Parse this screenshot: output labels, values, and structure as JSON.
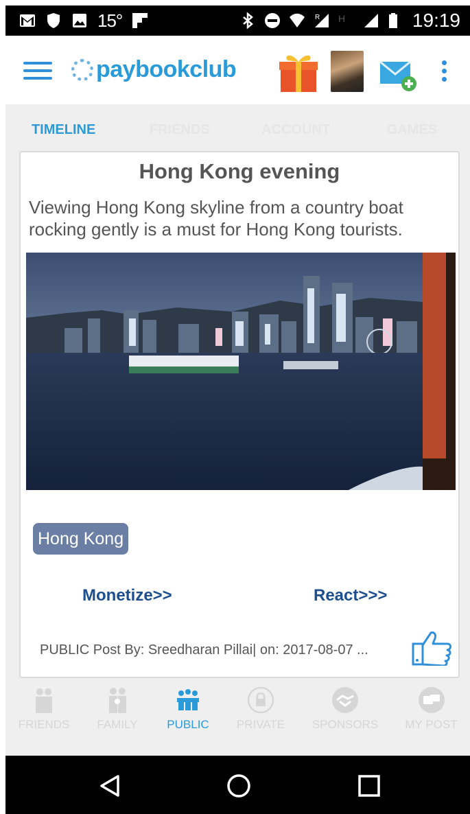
{
  "status_bar": {
    "temperature": "15°",
    "time": "19:19",
    "icons": [
      "gmail-icon",
      "shield-icon",
      "image-icon",
      "flipboard-icon",
      "bluetooth-icon",
      "do-not-disturb-icon",
      "wifi-icon",
      "roaming-signal-icon",
      "h-network-icon",
      "signal-icon",
      "battery-icon"
    ]
  },
  "app_bar": {
    "logo_text": "paybookclub",
    "icons": [
      "menu-icon",
      "gift-icon",
      "profile-avatar",
      "mail-add-icon",
      "more-vert-icon"
    ]
  },
  "tabs": [
    {
      "label": "TIMELINE",
      "active": true
    },
    {
      "label": "FRIENDS",
      "active": false
    },
    {
      "label": "ACCOUNT",
      "active": false
    },
    {
      "label": "GAMES",
      "active": false
    }
  ],
  "post": {
    "title": "Hong Kong evening",
    "description": "Viewing Hong Kong skyline from a country boat rocking gently is a must for Hong Kong tourists.",
    "tag": "Hong Kong",
    "monetize_label": "Monetize>>",
    "react_label": "React>>>",
    "footer": "PUBLIC Post By: Sreedharan Pillai| on: 2017-08-07 ..."
  },
  "categories": [
    {
      "label": "FRIENDS",
      "icon": "friends-icon",
      "active": false
    },
    {
      "label": "FAMILY",
      "icon": "family-icon",
      "active": false
    },
    {
      "label": "PUBLIC",
      "icon": "public-icon",
      "active": true
    },
    {
      "label": "PRIVATE",
      "icon": "lock-icon",
      "active": false
    },
    {
      "label": "SPONSORS",
      "icon": "handshake-icon",
      "active": false
    },
    {
      "label": "MY POST",
      "icon": "my-post-icon",
      "active": false
    }
  ],
  "nav": {
    "icons": [
      "back-icon",
      "home-icon",
      "recents-icon"
    ]
  },
  "colors": {
    "accent": "#2a9bd8",
    "tag_bg": "#6b7fa5",
    "action_text": "#1d4f8f",
    "inactive_tab": "#e6e6e6"
  }
}
